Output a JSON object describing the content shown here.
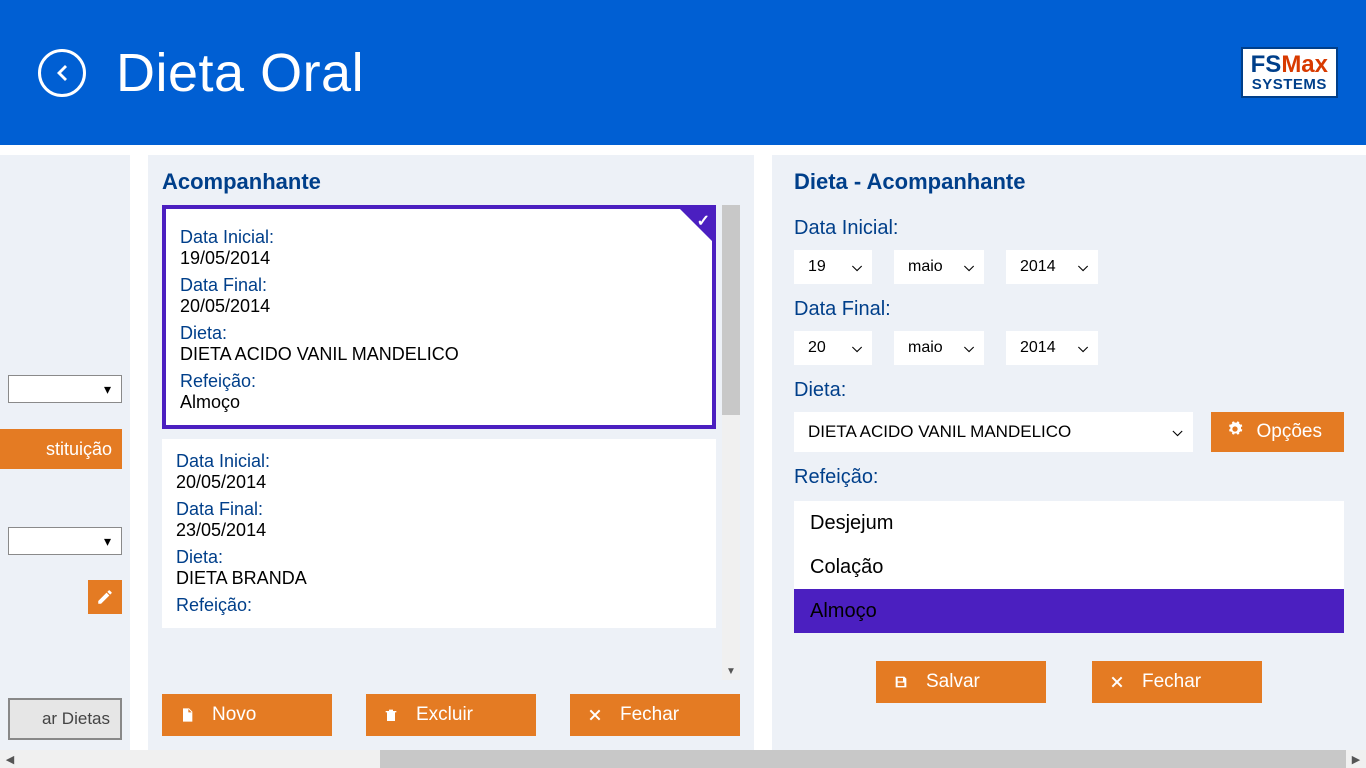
{
  "header": {
    "title": "Dieta Oral",
    "logo_top_a": "FS",
    "logo_top_b": "Max",
    "logo_bottom": "SYSTEMS"
  },
  "left_fragment": {
    "substituicao_label": "stituição",
    "copy_label": "ar Dietas"
  },
  "mid": {
    "title": "Acompanhante",
    "labels": {
      "data_inicial": "Data Inicial:",
      "data_final": "Data Final:",
      "dieta": "Dieta:",
      "refeicao": "Refeição:"
    },
    "cards": [
      {
        "selected": true,
        "data_inicial": "19/05/2014",
        "data_final": "20/05/2014",
        "dieta": "DIETA ACIDO VANIL MANDELICO",
        "refeicao": "Almoço"
      },
      {
        "selected": false,
        "data_inicial": "20/05/2014",
        "data_final": "23/05/2014",
        "dieta": "DIETA BRANDA",
        "refeicao": ""
      }
    ],
    "actions": {
      "novo": "Novo",
      "excluir": "Excluir",
      "fechar": "Fechar"
    }
  },
  "right": {
    "title": "Dieta - Acompanhante",
    "labels": {
      "data_inicial": "Data Inicial:",
      "data_final": "Data Final:",
      "dieta": "Dieta:",
      "refeicao": "Refeição:"
    },
    "data_inicial": {
      "day": "19",
      "month": "maio",
      "year": "2014"
    },
    "data_final": {
      "day": "20",
      "month": "maio",
      "year": "2014"
    },
    "dieta_value": "DIETA ACIDO VANIL MANDELICO",
    "opcoes_label": "Opções",
    "refeicoes": [
      {
        "label": "Desjejum",
        "selected": false
      },
      {
        "label": "Colação",
        "selected": false
      },
      {
        "label": "Almoço",
        "selected": true
      }
    ],
    "actions": {
      "salvar": "Salvar",
      "fechar": "Fechar"
    }
  }
}
